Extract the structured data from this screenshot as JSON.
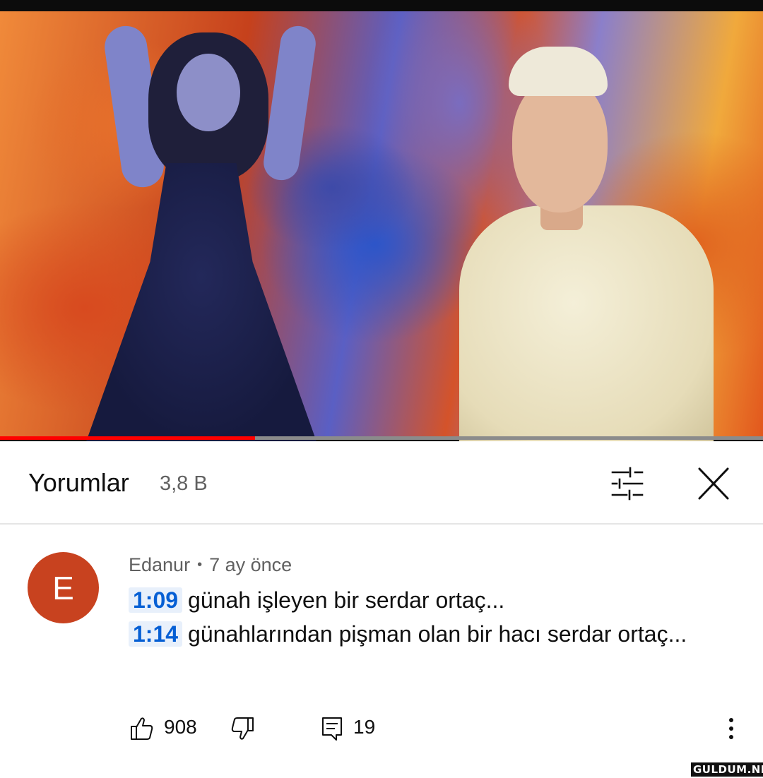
{
  "video": {
    "progress_fraction": 0.334
  },
  "comments_panel": {
    "title": "Yorumlar",
    "count": "3,8 B",
    "filter_icon": "sliders-icon",
    "close_icon": "close-icon"
  },
  "comment": {
    "avatar_letter": "E",
    "avatar_color": "#c8421f",
    "author": "Edanur",
    "separator": "•",
    "time_ago": "7 ay önce",
    "lines": [
      {
        "timestamp": "1:09",
        "text": "günah işleyen bir serdar ortaç..."
      },
      {
        "timestamp": "1:14",
        "text": "günahlarından pişman olan bir hacı serdar ortaç..."
      }
    ],
    "likes": "908",
    "replies": "19",
    "like_icon": "thumbs-up-icon",
    "dislike_icon": "thumbs-down-icon",
    "reply_icon": "comment-icon",
    "more_icon": "more-vertical-icon"
  },
  "watermark": "GULDUM.NET",
  "colors": {
    "progress": "#ff0000",
    "timestamp_link": "#065fd4",
    "secondary_text": "#606060"
  }
}
